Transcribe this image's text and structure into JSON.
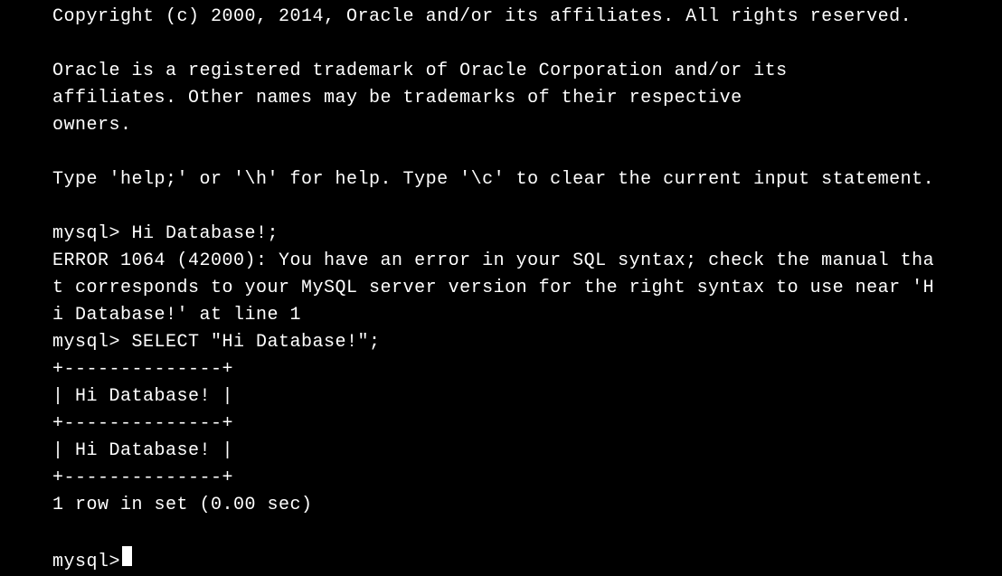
{
  "terminal": {
    "copyright": "Copyright (c) 2000, 2014, Oracle and/or its affiliates. All rights reserved.",
    "trademark_line1": "Oracle is a registered trademark of Oracle Corporation and/or its",
    "trademark_line2": "affiliates. Other names may be trademarks of their respective",
    "trademark_line3": "owners.",
    "help_text": "Type 'help;' or '\\h' for help. Type '\\c' to clear the current input statement.",
    "prompt1": "mysql> Hi Database!;",
    "error_line1": "ERROR 1064 (42000): You have an error in your SQL syntax; check the manual tha",
    "error_line2": "t corresponds to your MySQL server version for the right syntax to use near 'H",
    "error_line3": "i Database!' at line 1",
    "prompt2": "mysql> SELECT \"Hi Database!\";",
    "table_border": "+--------------+",
    "table_header": "| Hi Database! |",
    "table_row": "| Hi Database! |",
    "result_summary": "1 row in set (0.00 sec)",
    "prompt3": "mysql> "
  }
}
